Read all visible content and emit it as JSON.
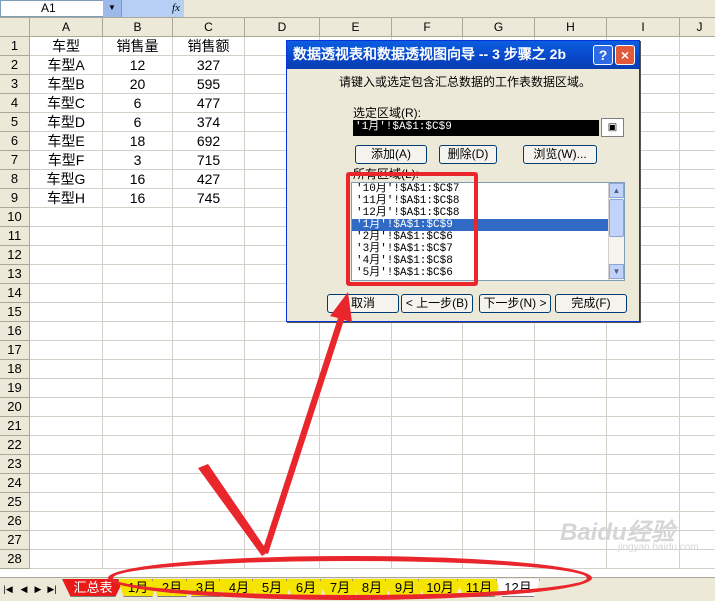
{
  "formula_bar": {
    "name_box": "A1",
    "fx_symbol": "fx"
  },
  "grid": {
    "columns": [
      "A",
      "B",
      "C",
      "D",
      "E",
      "F",
      "G",
      "H",
      "I",
      "J"
    ],
    "rows": [
      "1",
      "2",
      "3",
      "4",
      "5",
      "6",
      "7",
      "8",
      "9",
      "10",
      "11",
      "12",
      "13",
      "14",
      "15",
      "16",
      "17",
      "18",
      "19",
      "20",
      "21",
      "22",
      "23",
      "24",
      "25",
      "26",
      "27",
      "28"
    ],
    "table": {
      "headers": [
        "车型",
        "销售量",
        "销售额"
      ],
      "rows": [
        [
          "车型A",
          "12",
          "327"
        ],
        [
          "车型B",
          "20",
          "595"
        ],
        [
          "车型C",
          "6",
          "477"
        ],
        [
          "车型D",
          "6",
          "374"
        ],
        [
          "车型E",
          "18",
          "692"
        ],
        [
          "车型F",
          "3",
          "715"
        ],
        [
          "车型G",
          "16",
          "427"
        ],
        [
          "车型H",
          "16",
          "745"
        ]
      ]
    }
  },
  "sheet_tabs": [
    "汇总表",
    "1月",
    "2月",
    "3月",
    "4月",
    "5月",
    "6月",
    "7月",
    "8月",
    "9月",
    "10月",
    "11月",
    "12月"
  ],
  "dialog": {
    "title": "数据透视表和数据透视图向导 -- 3 步骤之 2b",
    "help_label": "?",
    "close_label": "×",
    "instruction": "请键入或选定包含汇总数据的工作表数据区域。",
    "range_label": "选定区域(R):",
    "range_value": "'1月'!$A$1:$C$9",
    "add_label": "添加(A)",
    "delete_label": "删除(D)",
    "browse_label": "浏览(W)...",
    "all_ranges_label": "所有区域(L):",
    "all_ranges": [
      "'10月'!$A$1:$C$7",
      "'11月'!$A$1:$C$8",
      "'12月'!$A$1:$C$8",
      "'1月'!$A$1:$C$9",
      "'2月'!$A$1:$C$6",
      "'3月'!$A$1:$C$7",
      "'4月'!$A$1:$C$8",
      "'5月'!$A$1:$C$6"
    ],
    "selected_index": 3,
    "cancel_label": "取消",
    "back_label": "< 上一步(B)",
    "next_label": "下一步(N) >",
    "finish_label": "完成(F)"
  },
  "watermark": {
    "text": "Baidu经验",
    "subtext": "jingyan.baidu.com"
  },
  "colors": {
    "annotation_red": "#e8262b",
    "tab_yellow": "#f5e400",
    "tab_red": "#e81a1a",
    "selection_blue": "#316ac5",
    "title_blue": "#0846c8"
  }
}
